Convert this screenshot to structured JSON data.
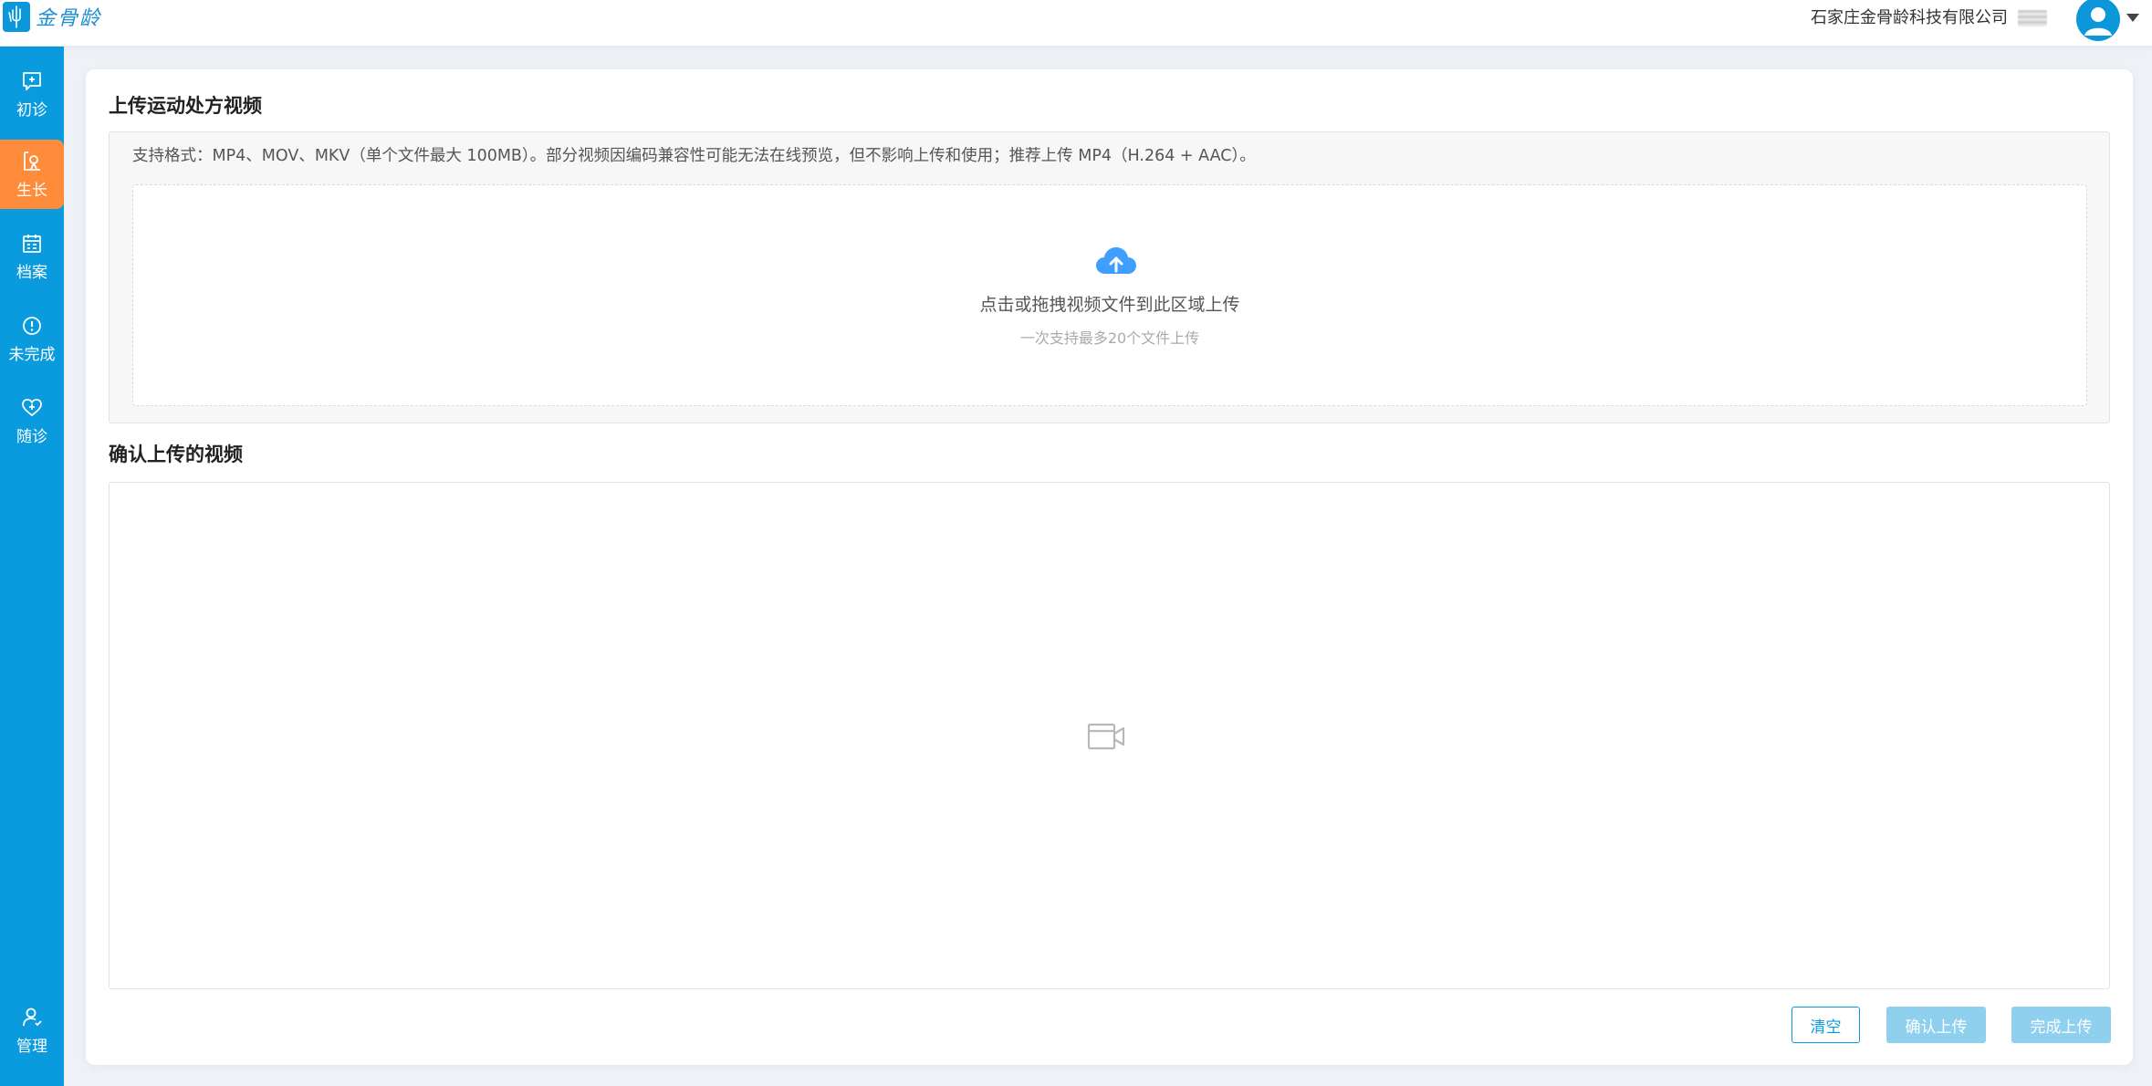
{
  "header": {
    "logo_text": "金骨龄",
    "company": "石家庄金骨龄科技有限公司"
  },
  "sidebar": {
    "items": [
      {
        "label": "初诊",
        "icon": "message-plus-icon"
      },
      {
        "label": "生长",
        "icon": "growth-chart-icon",
        "active": true
      },
      {
        "label": "档案",
        "icon": "calendar-file-icon"
      },
      {
        "label": "未完成",
        "icon": "alert-circle-icon"
      },
      {
        "label": "随诊",
        "icon": "heart-plus-icon"
      },
      {
        "label": "管理",
        "icon": "user-manage-icon"
      }
    ]
  },
  "upload": {
    "title": "上传运动处方视频",
    "format_tip": "支持格式：MP4、MOV、MKV（单个文件最大 100MB）。部分视频因编码兼容性可能无法在线预览，但不影响上传和使用；推荐上传 MP4（H.264 + AAC）。",
    "drop_text": "点击或拖拽视频文件到此区域上传",
    "drop_hint": "一次支持最多20个文件上传"
  },
  "confirm": {
    "title": "确认上传的视频"
  },
  "buttons": {
    "clear": "清空",
    "confirm_upload": "确认上传",
    "finish_upload": "完成上传"
  },
  "colors": {
    "sidebar": "#0a9bdf",
    "active_nav": "#ff8c3a",
    "primary": "#0a9bdf",
    "disabled_button": "#8fd0ef",
    "upload_icon": "#409eff"
  }
}
